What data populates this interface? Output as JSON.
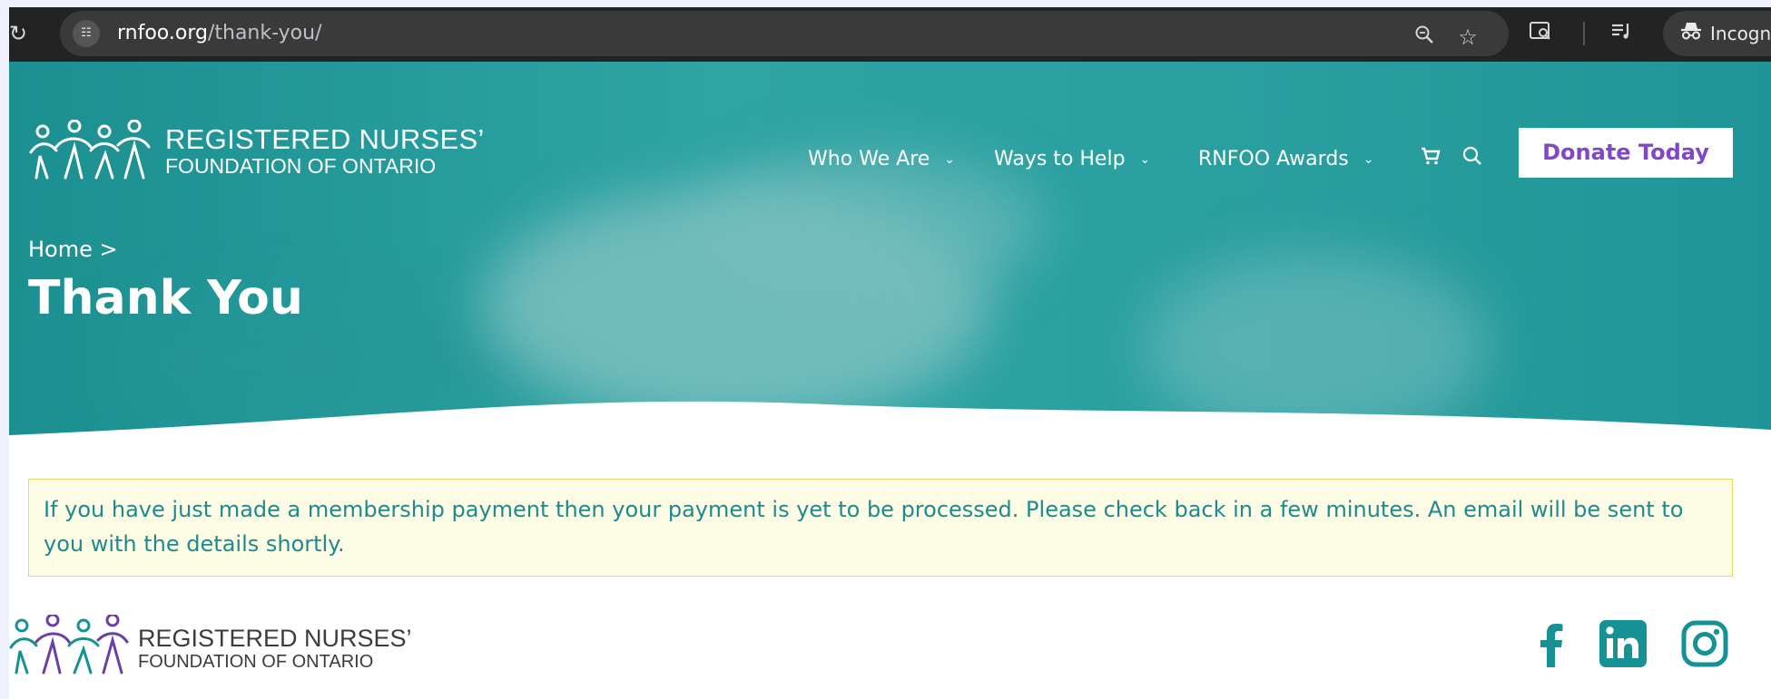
{
  "browser": {
    "reload_icon": "reload-icon",
    "site_info_icon": "tune-icon",
    "url_host": "rnfoo.org",
    "url_path": "/thank-you/",
    "toolbar_icons": [
      "zoom-icon",
      "star-icon",
      "lens-icon",
      "reading-list-icon",
      "incognito-icon"
    ],
    "incognito_label": "Incogn"
  },
  "header": {
    "logo_line1": "REGISTERED NURSES’",
    "logo_line2": "FOUNDATION OF ONTARIO",
    "nav": [
      {
        "label": "Who We Are"
      },
      {
        "label": "Ways to Help"
      },
      {
        "label": "RNFOO Awards"
      }
    ],
    "cart_icon": "cart-icon",
    "search_icon": "search-icon",
    "donate_label": "Donate Today"
  },
  "hero": {
    "breadcrumb": "Home >",
    "title": "Thank You"
  },
  "notice": {
    "text": "If you have just made a membership payment then your payment is yet to be processed. Please check back in a few minutes. An email will be sent to you with the details shortly."
  },
  "footer": {
    "logo_line1": "REGISTERED NURSES’",
    "logo_line2": "FOUNDATION OF ONTARIO",
    "social": [
      "facebook-icon",
      "linkedin-icon",
      "instagram-icon"
    ]
  },
  "colors": {
    "teal": "#2ea4a3",
    "brand_teal": "#179294",
    "brand_purple": "#6a3fa6",
    "donate_text": "#8246c9",
    "notice_bg": "#fdfde6",
    "notice_text": "#1e8a8e"
  }
}
